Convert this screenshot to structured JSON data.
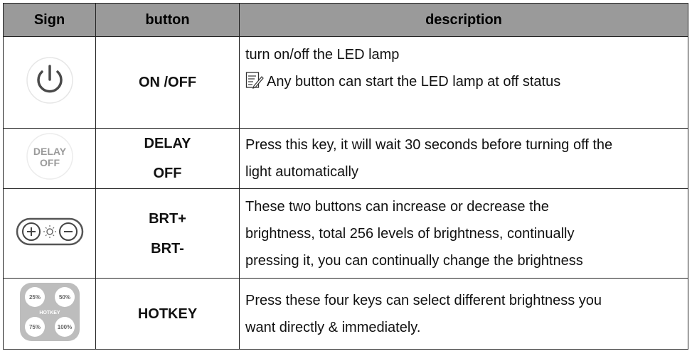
{
  "headers": {
    "sign": "Sign",
    "button": "button",
    "description": "description"
  },
  "rows": [
    {
      "button": [
        "ON /OFF"
      ],
      "description": [
        "turn on/off the LED lamp"
      ],
      "note": "Any button can start the LED lamp at off status",
      "icon": "power-icon"
    },
    {
      "button": [
        "DELAY",
        "OFF"
      ],
      "description": [
        "Press this key, it will wait 30 seconds before turning off the",
        "light automatically"
      ],
      "icon_text": [
        "DELAY",
        "OFF"
      ],
      "icon": "delay-off-icon"
    },
    {
      "button": [
        "BRT+",
        "BRT-"
      ],
      "description": [
        "These two buttons can increase or decrease the",
        "brightness, total 256 levels of brightness, continually",
        "pressing it, you can continually change the brightness"
      ],
      "icon": "brightness-plus-minus-icon"
    },
    {
      "button": [
        "HOTKEY"
      ],
      "description": [
        "Press these four keys can select different brightness you",
        "want directly & immediately."
      ],
      "icon_text": [
        "25%",
        "50%",
        "HOTKEY",
        "75%",
        "100%"
      ],
      "icon": "hotkey-pad-icon"
    }
  ],
  "colors": {
    "header_bg": "#9a9a9a",
    "border": "#222222",
    "icon_gray": "#bdbdbd"
  }
}
